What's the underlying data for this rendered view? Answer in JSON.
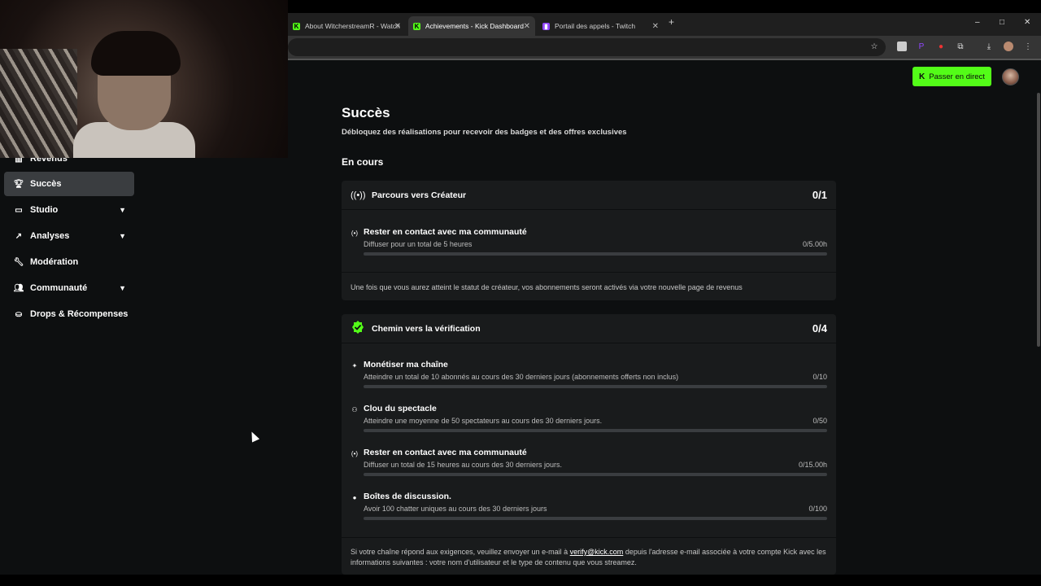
{
  "browser": {
    "tabs": [
      {
        "title": "About WitcherstreamR - Watch",
        "favicon": "kick-icon",
        "favicon_color": "#53fc18"
      },
      {
        "title": "Achievements - Kick Dashboard",
        "favicon": "kick-icon",
        "favicon_color": "#53fc18"
      },
      {
        "title": "Portail des appels - Twitch",
        "favicon": "twitch-icon",
        "favicon_color": "#9146ff"
      }
    ],
    "new_tab": "+",
    "window_controls": {
      "minimize": "–",
      "maximize": "□",
      "close": "✕"
    }
  },
  "sidebar": {
    "items": [
      {
        "label": "Revenus",
        "icon": "chart-bar-icon",
        "has_chevron": false
      },
      {
        "label": "Succès",
        "icon": "trophy-icon",
        "active": true,
        "has_chevron": false
      },
      {
        "label": "Studio",
        "icon": "studio-icon",
        "has_chevron": true
      },
      {
        "label": "Analyses",
        "icon": "analytics-icon",
        "has_chevron": true
      },
      {
        "label": "Modération",
        "icon": "wrench-icon",
        "has_chevron": false
      },
      {
        "label": "Communauté",
        "icon": "community-icon",
        "has_chevron": true
      },
      {
        "label": "Drops & Récompenses",
        "icon": "drops-icon",
        "has_chevron": false
      }
    ]
  },
  "header": {
    "go_live_label": "Passer en direct",
    "go_live_color": "#53fc18"
  },
  "main": {
    "title": "Succès",
    "subtitle": "Débloquez des réalisations pour recevoir des badges et des offres exclusives",
    "section": "En cours",
    "cards": [
      {
        "title": "Parcours vers Créateur",
        "count": "0/1",
        "tasks": [
          {
            "title": "Rester en contact avec ma communauté",
            "desc": "Diffuser pour un total de 5 heures",
            "value": "0/5.00h",
            "progress": 0
          }
        ],
        "footer": "Une fois que vous aurez atteint le statut de créateur, vos abonnements seront activés via votre nouvelle page de revenus"
      },
      {
        "title": "Chemin vers la vérification",
        "count": "0/4",
        "tasks": [
          {
            "title": "Monétiser ma chaîne",
            "desc": "Atteindre un total de 10 abonnés au cours des 30 derniers jours (abonnements offerts non inclus)",
            "value": "0/10",
            "progress": 0
          },
          {
            "title": "Clou du spectacle",
            "desc": "Atteindre une moyenne de 50 spectateurs au cours des 30 derniers jours.",
            "value": "0/50",
            "progress": 0
          },
          {
            "title": "Rester en contact avec ma communauté",
            "desc": "Diffuser un total de 15 heures au cours des 30 derniers jours.",
            "value": "0/15.00h",
            "progress": 0
          },
          {
            "title": "Boîtes de discussion.",
            "desc": "Avoir 100 chatter uniques au cours des 30 derniers jours",
            "value": "0/100",
            "progress": 0
          }
        ],
        "footer_pre": "Si votre chaîne répond aux exigences, veuillez envoyer un e-mail à ",
        "footer_link": "verify@kick.com",
        "footer_post": " depuis l'adresse e-mail associée à votre compte Kick avec les informations suivantes : votre nom d'utilisateur et le type de contenu que vous streamez."
      }
    ]
  }
}
